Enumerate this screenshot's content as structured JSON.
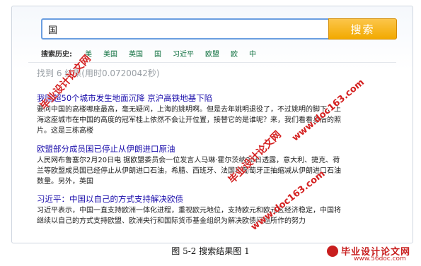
{
  "search": {
    "value": "国",
    "button_label": "搜索"
  },
  "history": {
    "label": "搜索历史:",
    "items": [
      "美",
      "美国",
      "英国",
      "国",
      "习近平",
      "欧盟",
      "欧",
      "中"
    ]
  },
  "stats": "找到 6 结果(用时0.0720042秒)",
  "results": [
    {
      "title": "我国超50个城市发生地面沉降 京沪高铁地基下陷",
      "snippet": "要问中国的高楼哪座最高，毫无疑问，上海的姚明啊。但是去年姚明退役了，不过姚明的脚下，上海这座城市在中国的高度的冠军桂上依然不会让开位置，接替它的是谁呢？来，我们看看身后的照片。这是三栋高楼"
    },
    {
      "title": "欧盟部分成员国已停止从伊朗进口原油",
      "snippet": "人民网布鲁塞尔2月20日电 据欧盟委员会一位发言人马琳·霍尔茨纳20日透露，意大利、捷克、荷兰等欧盟成员国已经停止从伊朗进口石油，希腊、西班牙、法国和葡萄牙正抽缩减从伊朗进口石油数量。另外，英国"
    },
    {
      "title": "习近平：中国以自己的方式支持解决欧债",
      "snippet": "习近平表示，中国一直支持欧洲一体化进程，重视欧元地位，支持欧元和欧元区经济稳定，中国将继续以自己的方式支持欧盟、欧洲央行和国际货币基金组织为解决欧债问题所作的努力"
    }
  ],
  "caption": "图 5-2 搜索结果图 1",
  "watermarks": [
    "毕业设计论文网",
    "www.doc163.com",
    "毕业设计论文网",
    "www.doc163.com"
  ],
  "brand": {
    "name": "毕业设计论文网",
    "url": "www.56doc.com"
  }
}
